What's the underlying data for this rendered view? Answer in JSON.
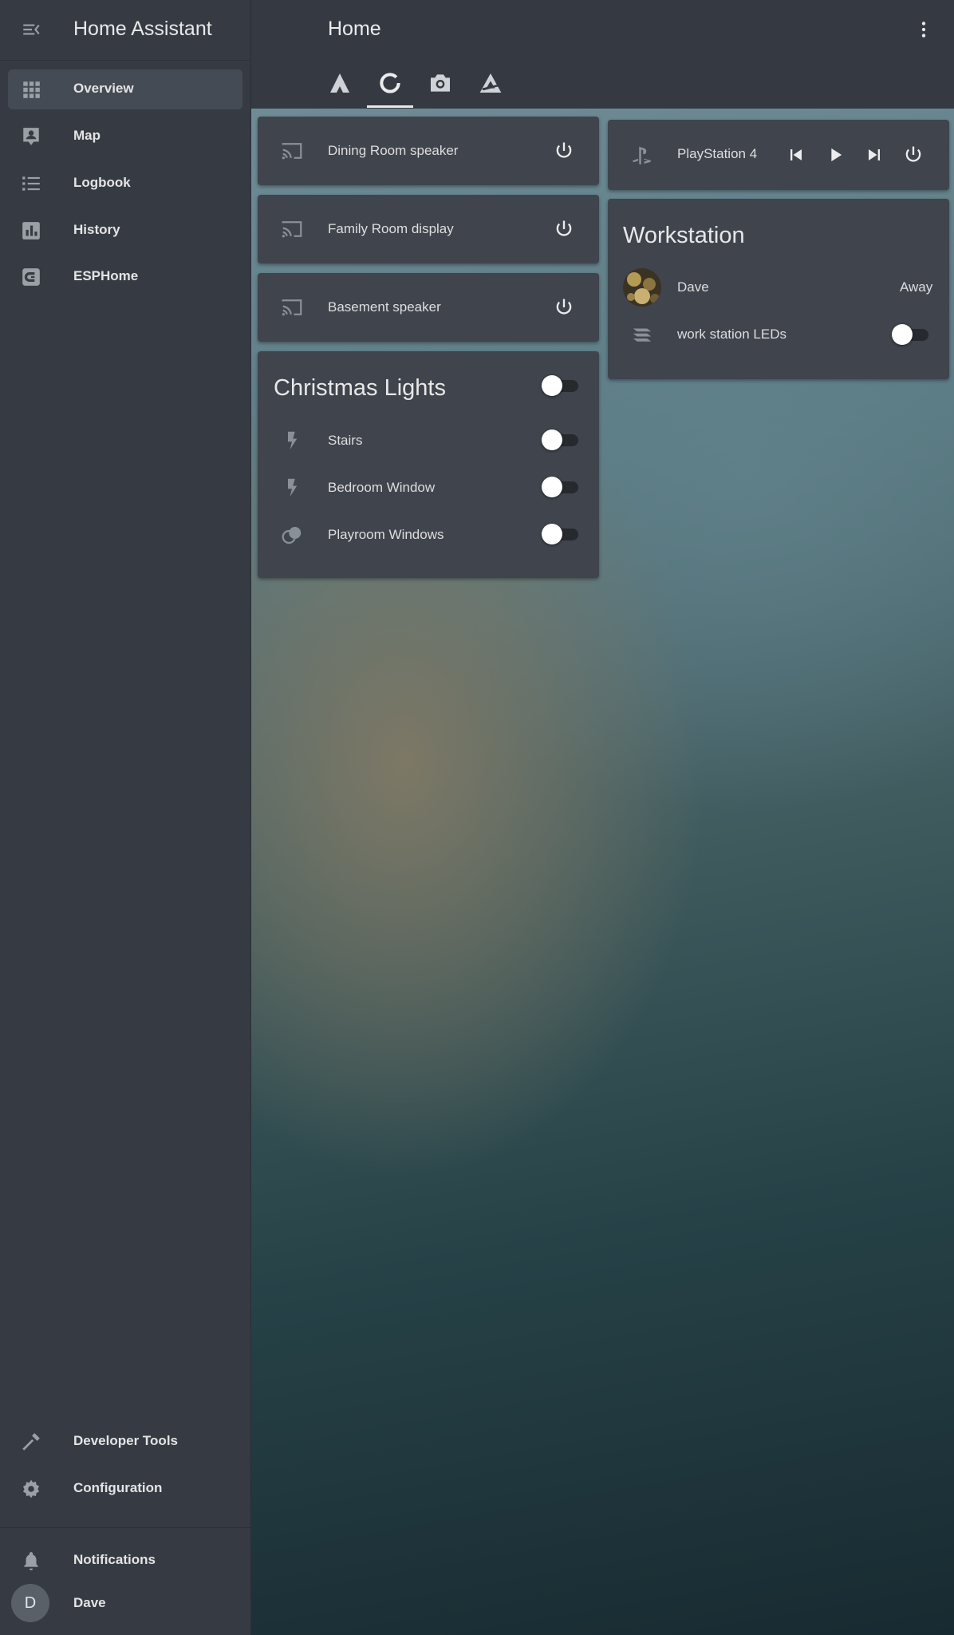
{
  "app": {
    "title": "Home Assistant"
  },
  "sidebar": {
    "items": [
      {
        "label": "Overview",
        "icon": "grid-icon",
        "active": true
      },
      {
        "label": "Map",
        "icon": "map-account-icon"
      },
      {
        "label": "Logbook",
        "icon": "list-icon"
      },
      {
        "label": "History",
        "icon": "chart-bar-icon"
      },
      {
        "label": "ESPHome",
        "icon": "esphome-icon"
      }
    ],
    "bottom_items": [
      {
        "label": "Developer Tools",
        "icon": "hammer-icon"
      },
      {
        "label": "Configuration",
        "icon": "gear-icon"
      }
    ],
    "notifications_label": "Notifications",
    "user": {
      "name": "Dave",
      "initial": "D"
    }
  },
  "header": {
    "title": "Home",
    "tabs": [
      {
        "icon": "triangle-icon"
      },
      {
        "icon": "ring-icon",
        "active": true
      },
      {
        "icon": "camera-icon"
      },
      {
        "icon": "delta-icon"
      }
    ]
  },
  "cards": {
    "media": [
      {
        "label": "Dining Room speaker",
        "icon": "cast-icon"
      },
      {
        "label": "Family Room display",
        "icon": "cast-icon"
      },
      {
        "label": "Basement speaker",
        "icon": "cast-icon"
      }
    ],
    "christmas": {
      "title": "Christmas Lights",
      "on": false,
      "rows": [
        {
          "label": "Stairs",
          "icon": "flash-icon",
          "on": false
        },
        {
          "label": "Bedroom Window",
          "icon": "flash-icon",
          "on": false
        },
        {
          "label": "Playroom Windows",
          "icon": "color-circles-icon",
          "on": false
        }
      ]
    },
    "playstation": {
      "label": "PlayStation 4",
      "icon": "playstation-icon"
    },
    "workstation": {
      "title": "Workstation",
      "person": {
        "name": "Dave",
        "state": "Away"
      },
      "led": {
        "label": "work station LEDs",
        "icon": "led-strip-icon",
        "on": false
      }
    }
  },
  "colors": {
    "sidebar_bg": "#363b43",
    "header_bg": "#353a42",
    "card_bg": "#3f444d",
    "active_nav": "#454b54",
    "text": "#e1e1e1"
  }
}
